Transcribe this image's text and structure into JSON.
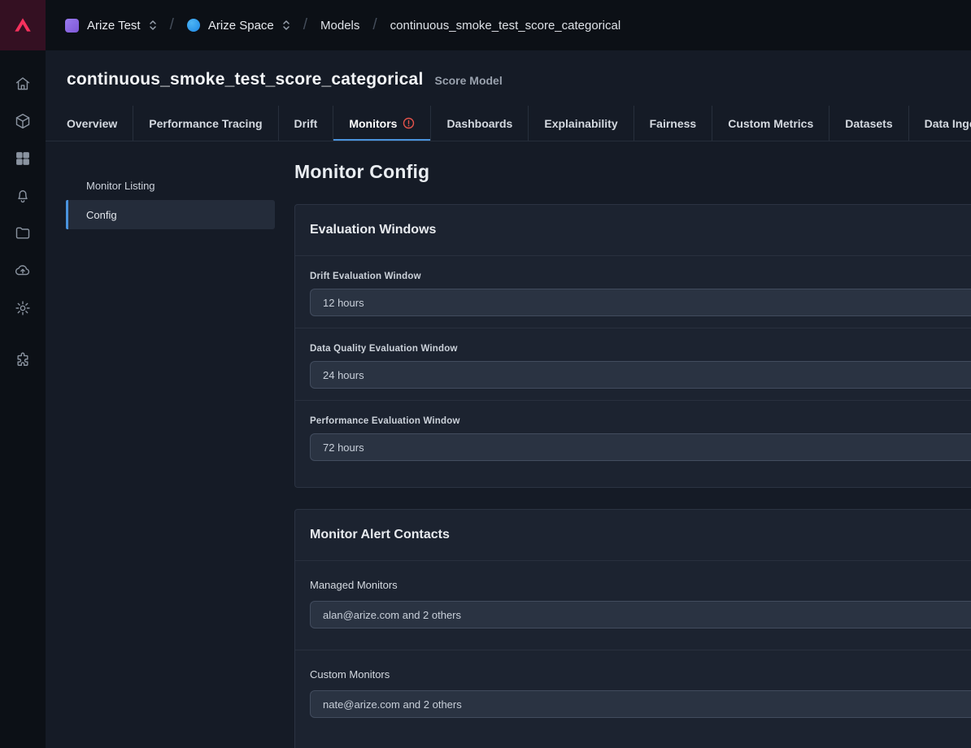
{
  "topbar": {
    "separator": "/",
    "org": {
      "label": "Arize Test"
    },
    "space": {
      "label": "Arize Space"
    },
    "models_crumb": "Models",
    "model_crumb": "continuous_smoke_test_score_categorical"
  },
  "sidebar": {
    "icons": [
      "home-icon",
      "models-cube-icon",
      "dashboards-grid-icon",
      "alerts-bell-icon",
      "projects-folder-icon",
      "upload-cloud-icon",
      "settings-gear-icon",
      "integrations-puzzle-icon"
    ]
  },
  "header": {
    "title": "continuous_smoke_test_score_categorical",
    "model_type": "Score Model"
  },
  "tabs": [
    {
      "label": "Overview",
      "active": false
    },
    {
      "label": "Performance Tracing",
      "active": false
    },
    {
      "label": "Drift",
      "active": false
    },
    {
      "label": "Monitors",
      "active": true,
      "badge": "warning"
    },
    {
      "label": "Dashboards",
      "active": false
    },
    {
      "label": "Explainability",
      "active": false
    },
    {
      "label": "Fairness",
      "active": false
    },
    {
      "label": "Custom Metrics",
      "active": false
    },
    {
      "label": "Datasets",
      "active": false
    },
    {
      "label": "Data Ingestion",
      "active": false
    }
  ],
  "subnav": {
    "items": [
      {
        "label": "Monitor Listing",
        "active": false
      },
      {
        "label": "Config",
        "active": true
      }
    ]
  },
  "main": {
    "title": "Monitor Config",
    "cards": [
      {
        "title": "Evaluation Windows",
        "fields": [
          {
            "label": "Drift Evaluation Window",
            "value": "12 hours"
          },
          {
            "label": "Data Quality Evaluation Window",
            "value": "24 hours"
          },
          {
            "label": "Performance Evaluation Window",
            "value": "72 hours"
          }
        ]
      },
      {
        "title": "Monitor Alert Contacts",
        "fields": [
          {
            "label": "Managed Monitors",
            "value": "alan@arize.com and 2 others"
          },
          {
            "label": "Custom Monitors",
            "value": "nate@arize.com and 2 others"
          }
        ]
      }
    ]
  },
  "colors": {
    "accent_blue": "#4a93dd",
    "warning_red": "#e5534b",
    "org_purple": "#8b6fe0",
    "space_blue": "#2196f3",
    "logo_pink": "#f5315d",
    "card_bg": "#1c2330",
    "input_bg": "#2a3342"
  }
}
